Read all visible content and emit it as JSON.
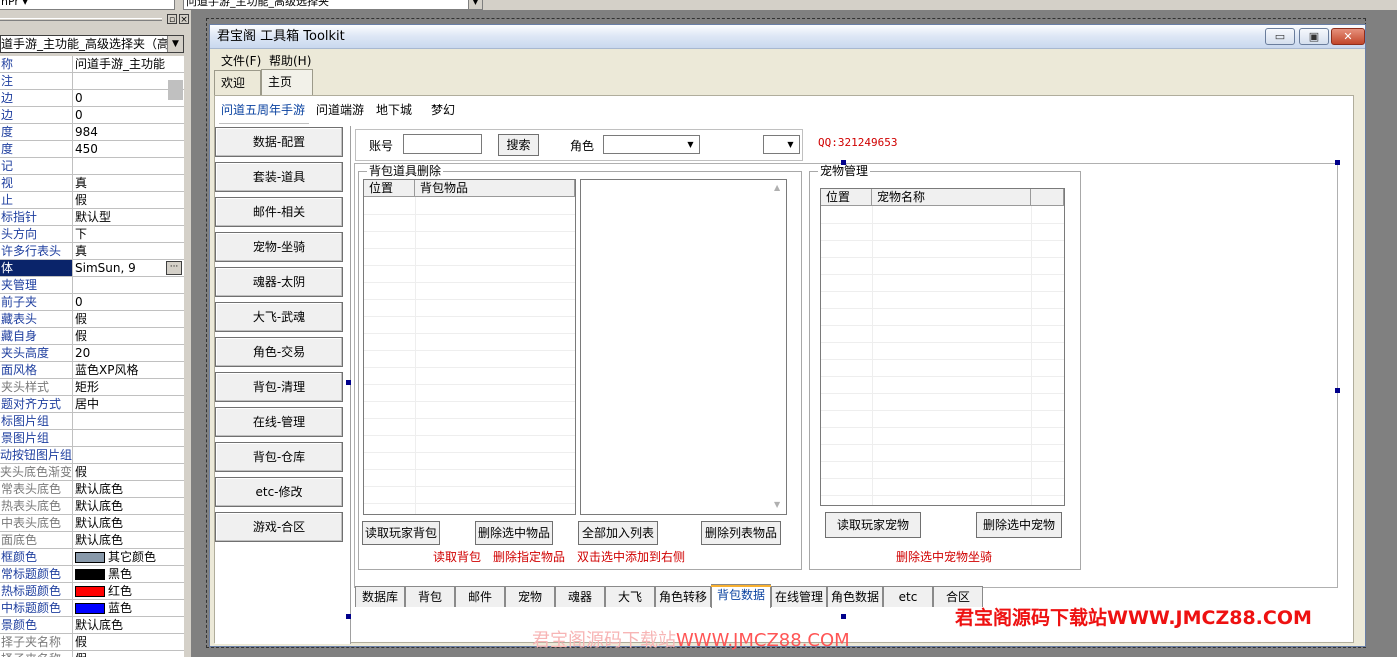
{
  "top_strip": {
    "combo_left": "hPr ▾",
    "combo_right": "问道手游_主功能_高级选择夹"
  },
  "property_panel": {
    "caption_buttons": [
      "▫",
      "×"
    ],
    "selector": "道手游_主功能_高级选择夹（高级",
    "rows": [
      {
        "name": "称",
        "value": "问道手游_主功能"
      },
      {
        "name": "注",
        "value": ""
      },
      {
        "name": "边",
        "value": "0"
      },
      {
        "name": "边",
        "value": "0"
      },
      {
        "name": "度",
        "value": "984"
      },
      {
        "name": "度",
        "value": "450"
      },
      {
        "name": "记",
        "value": ""
      },
      {
        "name": "视",
        "value": "真"
      },
      {
        "name": "止",
        "value": "假"
      },
      {
        "name": "标指针",
        "value": "默认型"
      },
      {
        "name": "头方向",
        "value": "下"
      },
      {
        "name": "许多行表头",
        "value": "真"
      },
      {
        "name": "体",
        "value": "SimSun, 9",
        "selected": true,
        "dots": true
      },
      {
        "name": "夹管理",
        "value": ""
      },
      {
        "name": "前子夹",
        "value": "0"
      },
      {
        "name": "藏表头",
        "value": "假"
      },
      {
        "name": "藏自身",
        "value": "假"
      },
      {
        "name": "夹头高度",
        "value": "20"
      },
      {
        "name": "面风格",
        "value": "蓝色XP风格"
      },
      {
        "name": "夹头样式",
        "value": "矩形",
        "gray": true
      },
      {
        "name": "题对齐方式",
        "value": "居中"
      },
      {
        "name": "标图片组",
        "value": ""
      },
      {
        "name": "景图片组",
        "value": ""
      },
      {
        "name": "动按钮图片组",
        "value": ""
      },
      {
        "name": "夹头底色渐变",
        "value": "假",
        "gray": true
      },
      {
        "name": "常表头底色",
        "value": "默认底色",
        "gray": true
      },
      {
        "name": "热表头底色",
        "value": "默认底色",
        "gray": true
      },
      {
        "name": "中表头底色",
        "value": "默认底色",
        "gray": true
      },
      {
        "name": "面底色",
        "value": "默认底色",
        "gray": true
      },
      {
        "name": "框颜色",
        "value": "其它颜色",
        "swatch": "#8899aa"
      },
      {
        "name": "常标题颜色",
        "value": "黑色",
        "swatch": "#000000"
      },
      {
        "name": "热标题颜色",
        "value": "红色",
        "swatch": "#ff0000"
      },
      {
        "name": "中标题颜色",
        "value": "蓝色",
        "swatch": "#0000ff"
      },
      {
        "name": "景颜色",
        "value": "默认底色"
      },
      {
        "name": "择子夹名称",
        "value": "假",
        "gray": true
      },
      {
        "name": "择子夹名称",
        "value": "假",
        "gray": true
      }
    ]
  },
  "window": {
    "title": "君宝阁 工具箱 Toolkit",
    "buttons": {
      "minimize": "▭",
      "restore": "▣",
      "close": "✕"
    },
    "menu": [
      "文件(F)",
      "帮助(H)"
    ],
    "outer_tabs": [
      "欢迎",
      "主页"
    ],
    "sub_tabs": [
      "问道五周年手游",
      "问道端游",
      "地下城",
      "梦幻"
    ],
    "nav_buttons": [
      "数据-配置",
      "套装-道具",
      "邮件-相关",
      "宠物-坐骑",
      "魂器-太阴",
      "大飞-武魂",
      "角色-交易",
      "背包-清理",
      "在线-管理",
      "背包-仓库",
      "etc-修改",
      "游戏-合区"
    ],
    "toolbar": {
      "account_label": "账号",
      "account_value": "",
      "search_button": "搜索",
      "role_label": "角色",
      "role_value": "",
      "small_combo_value": "",
      "qq_text": "QQ:321249653"
    },
    "backpack_group": {
      "title": "背包道具删除",
      "columns": [
        "位置",
        "背包物品"
      ],
      "buttons": [
        "读取玩家背包",
        "删除选中物品",
        "全部加入列表",
        "删除列表物品"
      ],
      "hints": [
        "读取背包",
        "删除指定物品",
        "双击选中添加到右侧"
      ]
    },
    "pet_group": {
      "title": "宠物管理",
      "columns": [
        "位置",
        "宠物名称",
        ""
      ],
      "buttons": [
        "读取玩家宠物",
        "删除选中宠物"
      ],
      "hint": "删除选中宠物坐骑"
    },
    "bottom_tabs": [
      "数据库",
      "背包",
      "邮件",
      "宠物",
      "魂器",
      "大飞",
      "角色转移",
      "背包数据",
      "在线管理",
      "角色数据",
      "etc",
      "合区"
    ],
    "bottom_tab_active": "背包数据"
  },
  "watermarks": {
    "right": "君宝阁源码下载站WWW.JMCZ88.COM",
    "center_faint": "君宝阁源码下载站",
    "center": "WWW.JMCZ88.COM"
  },
  "colors": {
    "accent": "#0a42a0",
    "warning_text": "#d00000",
    "selection": "#0a246a",
    "tab_highlight": "#f8b030"
  }
}
